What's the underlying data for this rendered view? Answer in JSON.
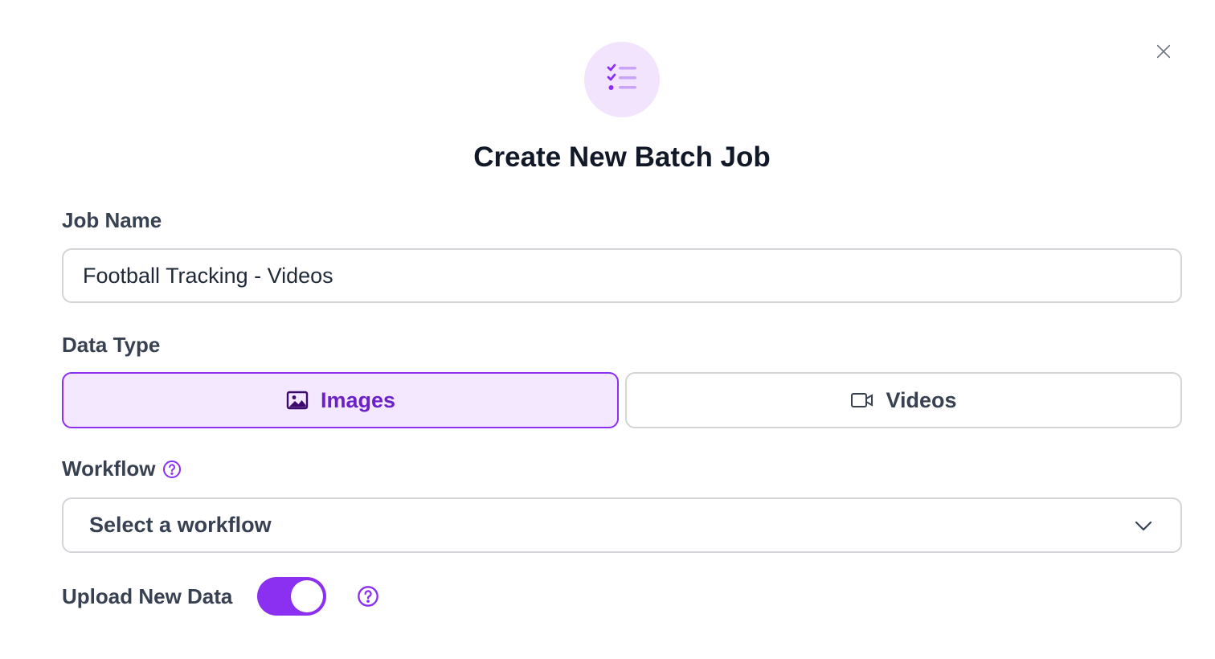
{
  "dialog": {
    "title": "Create New Batch Job",
    "header_icon": "checklist-icon",
    "close_icon": "close-icon"
  },
  "job_name": {
    "label": "Job Name",
    "value": "Football Tracking - Videos"
  },
  "data_type": {
    "label": "Data Type",
    "options": [
      {
        "label": "Images",
        "icon": "image-icon",
        "selected": true
      },
      {
        "label": "Videos",
        "icon": "video-icon",
        "selected": false
      }
    ]
  },
  "workflow": {
    "label": "Workflow",
    "help_icon": "help-icon",
    "placeholder": "Select a workflow",
    "dropdown_icon": "chevron-down-icon"
  },
  "upload_new_data": {
    "label": "Upload New Data",
    "enabled": true,
    "help_icon": "help-icon"
  },
  "colors": {
    "accent": "#8b2ff0",
    "accent_light": "#f3e8ff",
    "icon_bg": "#f1e4fc"
  }
}
